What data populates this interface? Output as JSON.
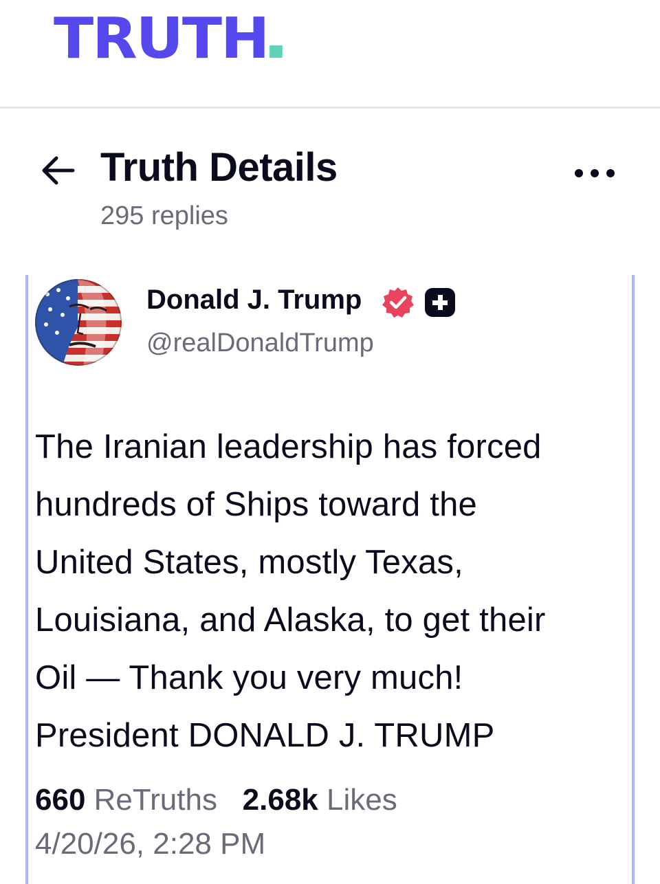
{
  "brand": {
    "logo_text": "TRUTH",
    "logo_color": "#5448ee",
    "dot_color": "#5fd3b8"
  },
  "header": {
    "title": "Truth Details",
    "replies": "295 replies",
    "back_icon": "arrow-left-icon",
    "more_icon": "more-horizontal-icon"
  },
  "post": {
    "author_name": "Donald J. Trump",
    "handle": "@realDonaldTrump",
    "verified_color": "#e9445f",
    "body_lines": [
      "The Iranian leadership has forced",
      "hundreds of Ships toward the",
      "United States, mostly Texas,",
      "Louisiana, and Alaska, to get their",
      "Oil — Thank you very much!",
      "President DONALD J. TRUMP"
    ],
    "retruths_count": "660",
    "retruths_label": "ReTruths",
    "likes_count": "2.68k",
    "likes_label": "Likes",
    "timestamp": "4/20/26, 2:28 PM",
    "accent_border": "#aab4ff"
  }
}
